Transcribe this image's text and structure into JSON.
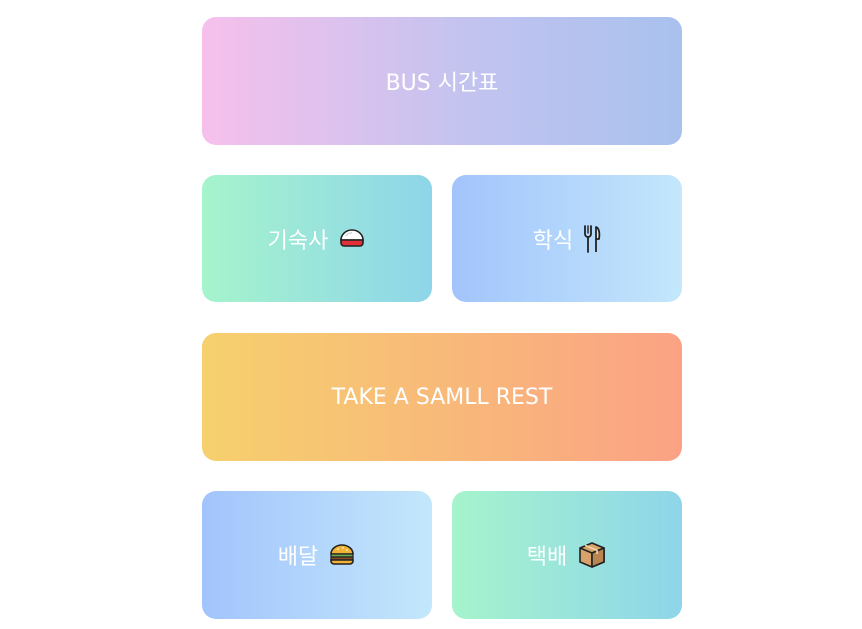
{
  "menu": {
    "bus": {
      "label": "BUS 시간표"
    },
    "dorm": {
      "label": "기숙사",
      "icon": "rice-ball-icon"
    },
    "cafeteria": {
      "label": "학식",
      "icon": "fork-knife-icon"
    },
    "rest": {
      "label": "TAKE A SAMLL REST"
    },
    "delivery": {
      "label": "배달",
      "icon": "burger-icon"
    },
    "parcel": {
      "label": "택배",
      "icon": "package-box-icon"
    }
  },
  "colors": {
    "bus_gradient": [
      "#f7c0ec",
      "#c3c3ef",
      "#a9c1ee"
    ],
    "green_gradient": [
      "#a5f4cc",
      "#8fd5ea"
    ],
    "blue_gradient": [
      "#a2c4fc",
      "#c3e7fb"
    ],
    "orange_gradient": [
      "#f6d06d",
      "#f8bc78",
      "#fba284"
    ],
    "text": "#ffffff"
  }
}
